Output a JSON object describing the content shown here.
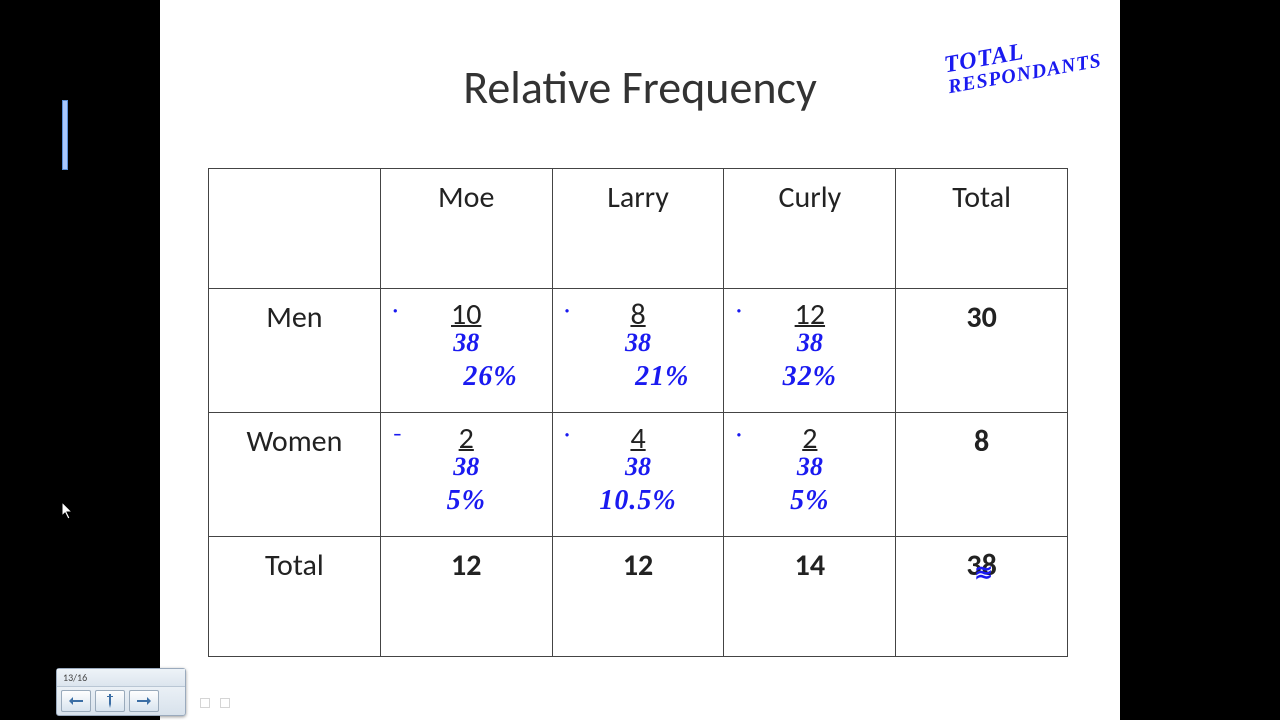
{
  "title": "Relative Frequency",
  "note_line1": "TOTAL",
  "note_line2": "RESPONDANTS",
  "columns": {
    "a": "Moe",
    "b": "Larry",
    "c": "Curly",
    "total": "Total"
  },
  "rows": {
    "men": {
      "label": "Men",
      "a_num": "10",
      "a_den": "38",
      "a_pct": "26%",
      "b_num": "8",
      "b_den": "38",
      "b_pct": "21%",
      "c_num": "12",
      "c_den": "38",
      "c_pct": "32%",
      "total": "30"
    },
    "women": {
      "label": "Women",
      "a_num": "2",
      "a_den": "38",
      "a_pct": "5%",
      "b_num": "4",
      "b_den": "38",
      "b_pct": "10.5%",
      "c_num": "2",
      "c_den": "38",
      "c_pct": "5%",
      "total": "8"
    },
    "totals": {
      "label": "Total",
      "a": "12",
      "b": "12",
      "c": "14",
      "grand": "38"
    }
  },
  "toolbar": {
    "page": "13/16"
  },
  "chart_data": {
    "type": "table",
    "title": "Relative Frequency",
    "note": "Total Respondants",
    "row_labels": [
      "Men",
      "Women"
    ],
    "col_labels": [
      "Moe",
      "Larry",
      "Curly"
    ],
    "counts": [
      [
        10,
        8,
        12
      ],
      [
        2,
        4,
        2
      ]
    ],
    "row_totals": [
      30,
      8
    ],
    "col_totals": [
      12,
      12,
      14
    ],
    "grand_total": 38,
    "relative_frequency_pct": [
      [
        26,
        21,
        32
      ],
      [
        5,
        10.5,
        5
      ]
    ],
    "denominator": 38
  }
}
